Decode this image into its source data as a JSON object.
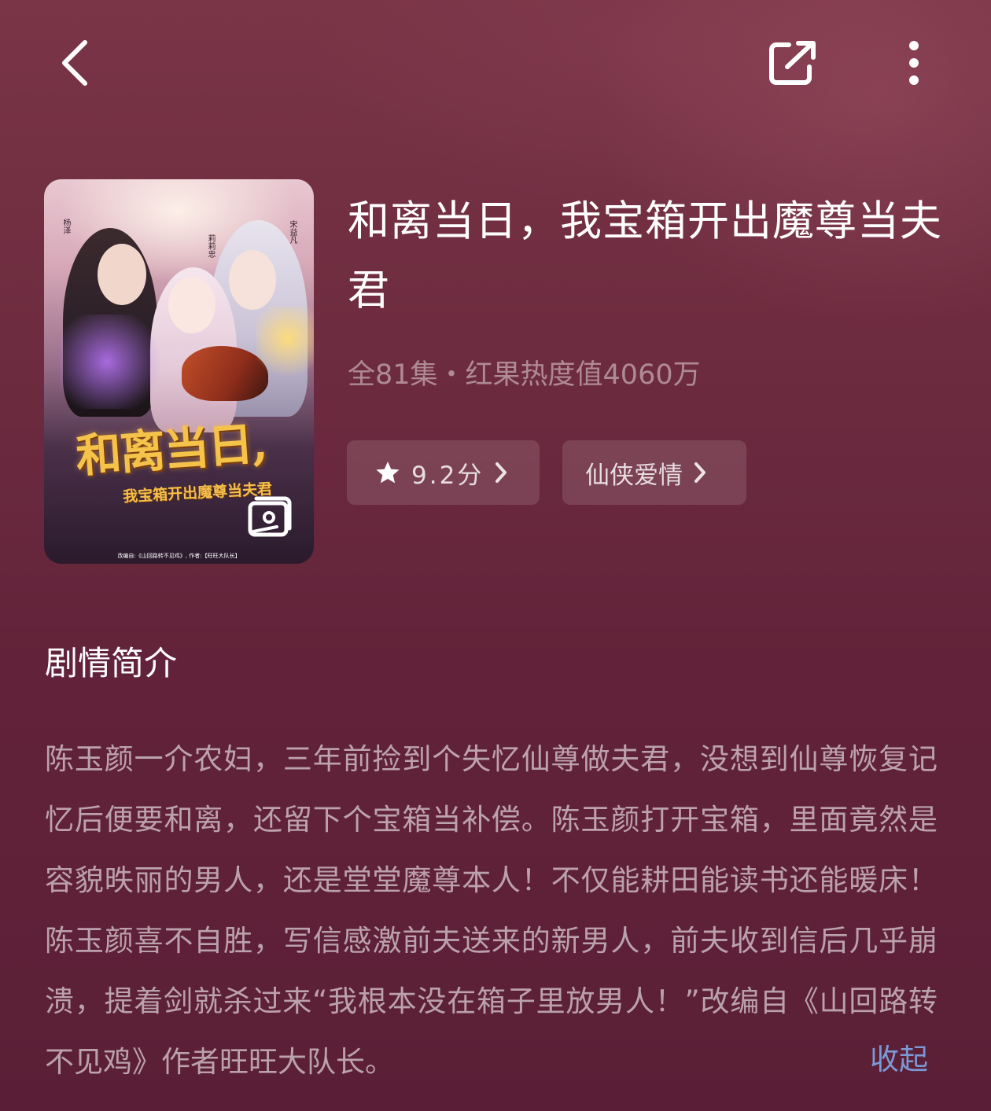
{
  "header": {
    "back_icon": "chevron-left-icon",
    "share_icon": "share-external-icon",
    "more_icon": "more-vertical-icon"
  },
  "poster": {
    "title_main": "和离当日,",
    "title_sub": "我宝箱开出魔尊当夫君",
    "credit": "改编自:《山回路转不见鸡》, 作者:【旺旺大队长】",
    "actor_left": "杨泽",
    "actor_middle": "莉莉忠",
    "actor_right": "宋益凡",
    "gallery_icon": "gallery-icon"
  },
  "drama": {
    "title": "和离当日，我宝箱开出魔尊当夫君",
    "meta": "全81集・红果热度值4060万",
    "rating_label": "9.2分",
    "genre_label": "仙侠爱情"
  },
  "synopsis": {
    "heading": "剧情简介",
    "text": "陈玉颜一介农妇，三年前捡到个失忆仙尊做夫君，没想到仙尊恢复记忆后便要和离，还留下个宝箱当补偿。陈玉颜打开宝箱，里面竟然是容貌昳丽的男人，还是堂堂魔尊本人！不仅能耕田能读书还能暖床！陈玉颜喜不自胜，写信感激前夫送来的新男人，前夫收到信后几乎崩溃，提着剑就杀过来“我根本没在箱子里放男人！”改编自《山回路转不见鸡》作者旺旺大队长。",
    "collapse_label": "收起"
  },
  "colors": {
    "background": "#6e2c40",
    "accent_link": "#7c99d6",
    "tag_background": "rgba(255,255,255,0.12)"
  }
}
